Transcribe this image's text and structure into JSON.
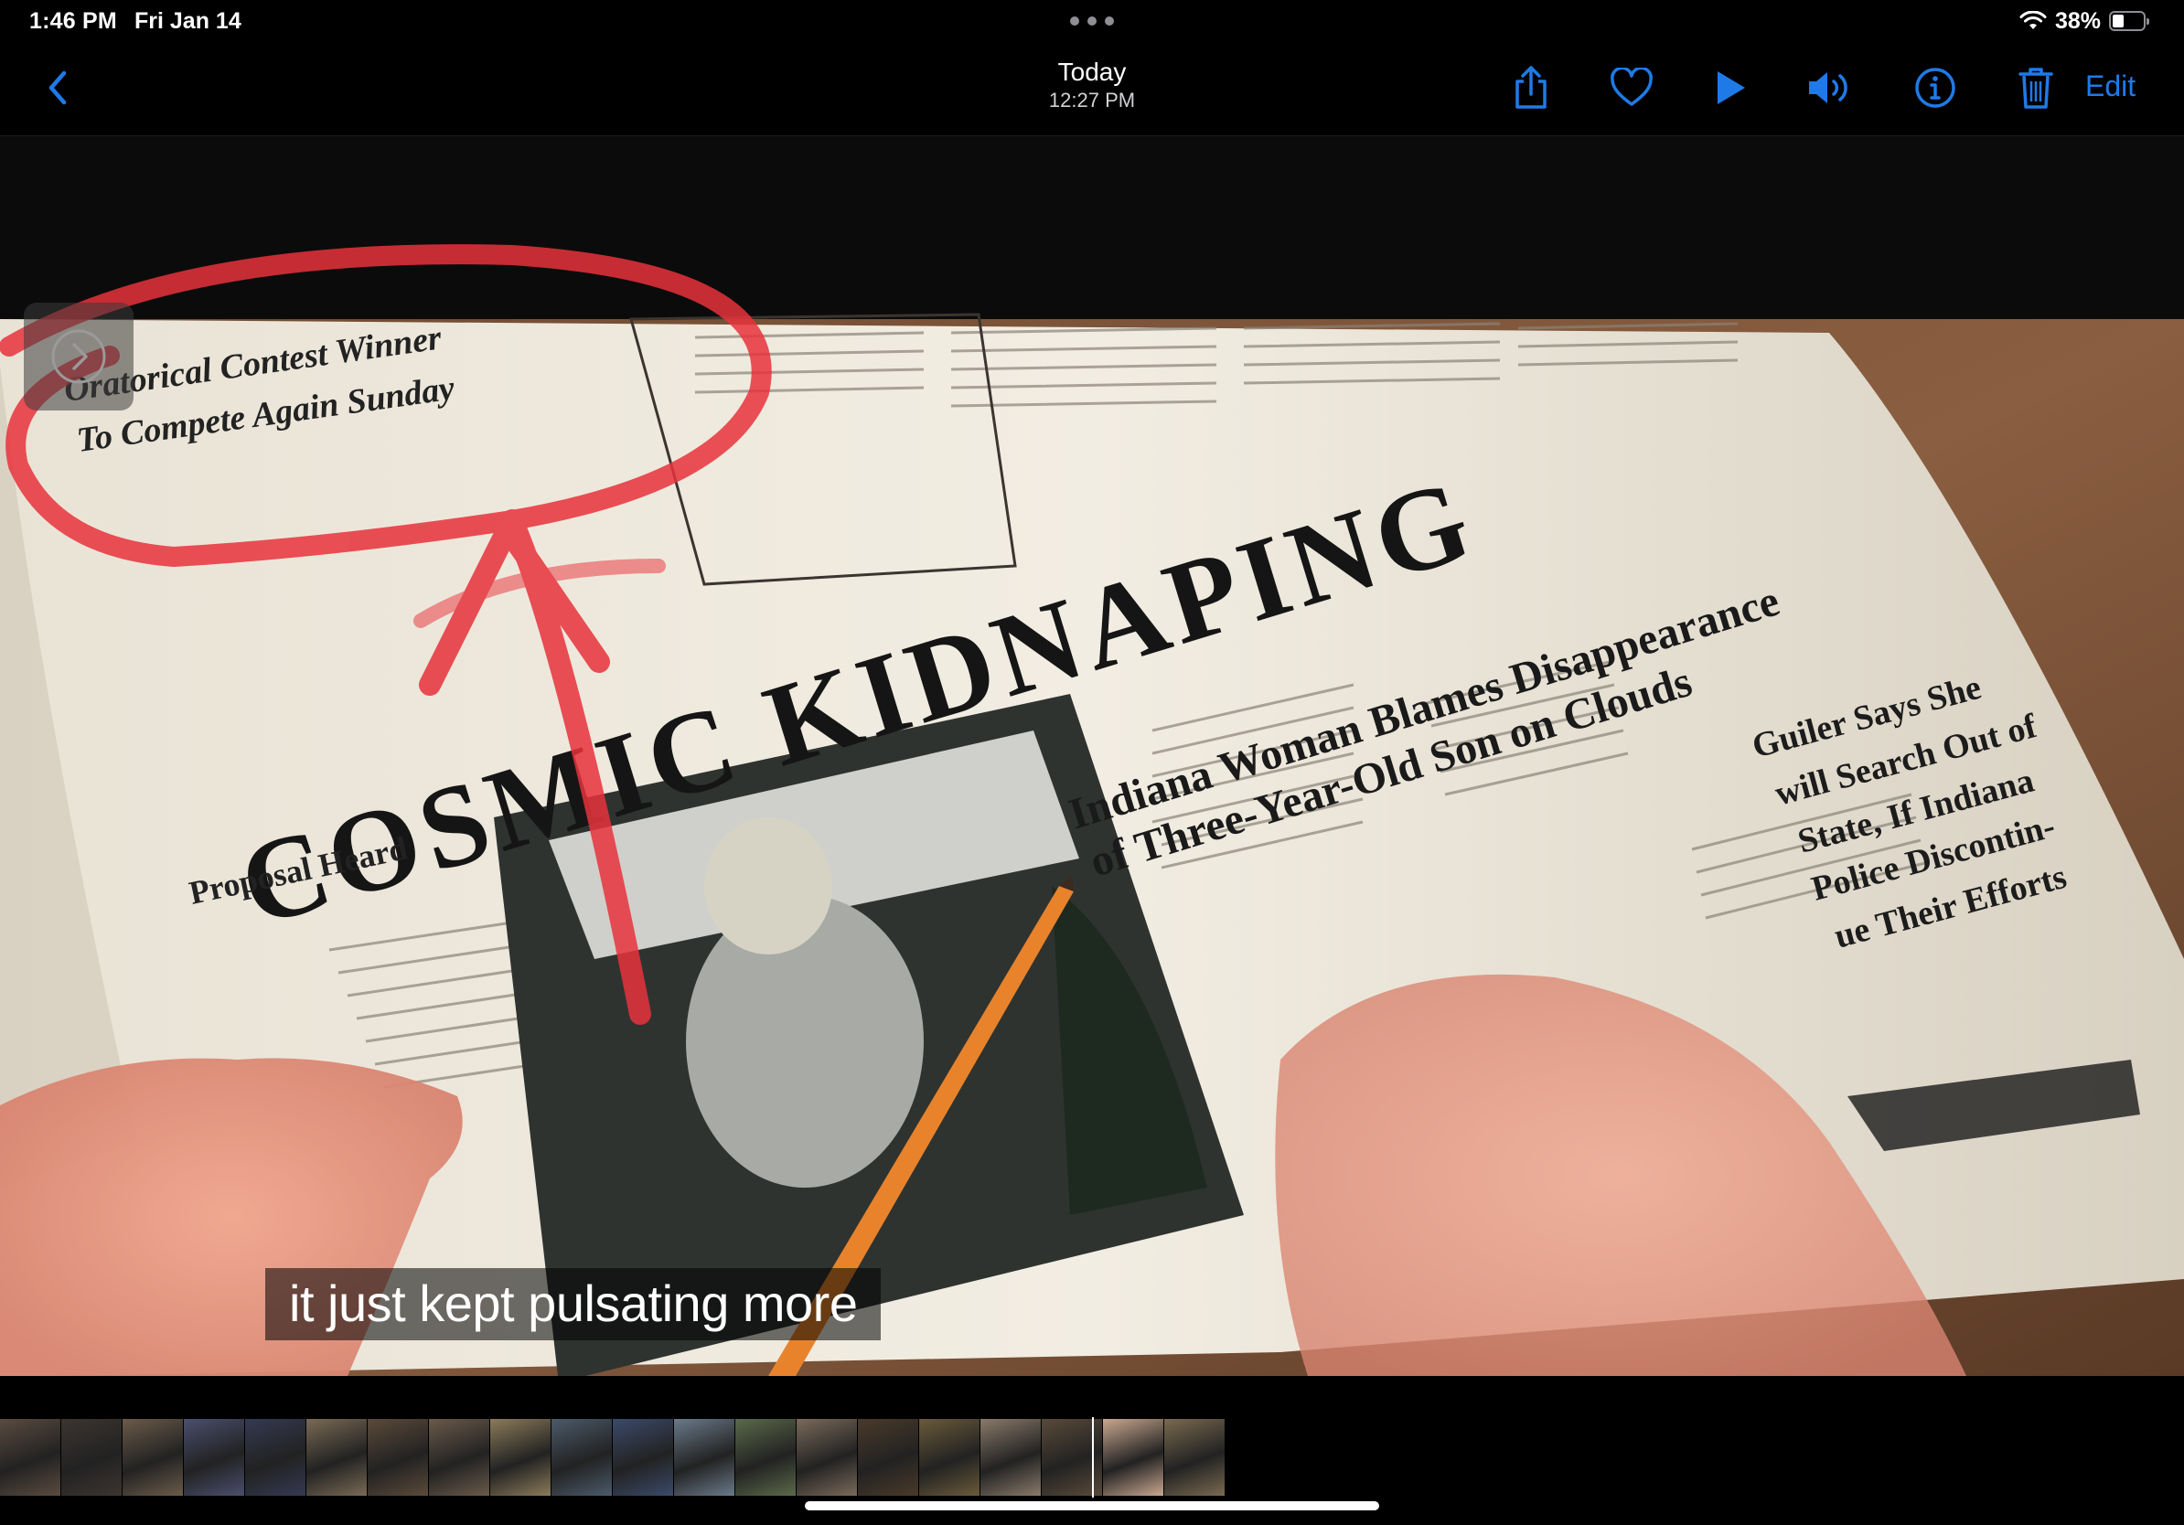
{
  "status": {
    "time": "1:46 PM",
    "date": "Fri Jan 14",
    "battery_percent_label": "38%",
    "battery_level": 0.38
  },
  "nav": {
    "back_icon": "chevron-left-icon",
    "title": "Today",
    "subtitle": "12:27 PM",
    "edit_label": "Edit",
    "icons": [
      "share-icon",
      "heart-icon",
      "play-icon",
      "speaker-icon",
      "info-icon",
      "trash-icon"
    ],
    "accent": "#1f7ae8"
  },
  "photo": {
    "panel_toggle_icon": "chevron-right-icon",
    "newspaper": {
      "headline": "COSMIC KIDNAPING",
      "deck_line1": "Indiana Woman Blames Disappearance",
      "deck_line2": "of Three-Year-Old Son on Clouds",
      "side_story_1": "Oratorical Contest Winner",
      "side_story_2": "To Compete Again Sunday",
      "side_story_3": "Proposal Heard",
      "right_story_1": "Guiler Says She",
      "right_story_2": "will Search Out of",
      "right_story_3": "State, If Indiana",
      "right_story_4": "Police Discontin-",
      "right_story_5": "ue Their Efforts"
    },
    "annotation_color": "#e8323c",
    "subtitle": "it just kept pulsating more"
  },
  "filmstrip": {
    "frame_colors": [
      "#5a4b3f",
      "#3c3530",
      "#6b5b4a",
      "#4a4f6e",
      "#343a52",
      "#7a6a55",
      "#5b4a3a",
      "#6a5a4a",
      "#8b7b5a",
      "#4b5a6a",
      "#3b4a6a",
      "#6a7a8a",
      "#5a6a4a",
      "#7a6a5a",
      "#4a3a2a",
      "#6a5a3a",
      "#8a7a6a",
      "#5a4a3a",
      "#caa890",
      "#7a6a50"
    ]
  }
}
